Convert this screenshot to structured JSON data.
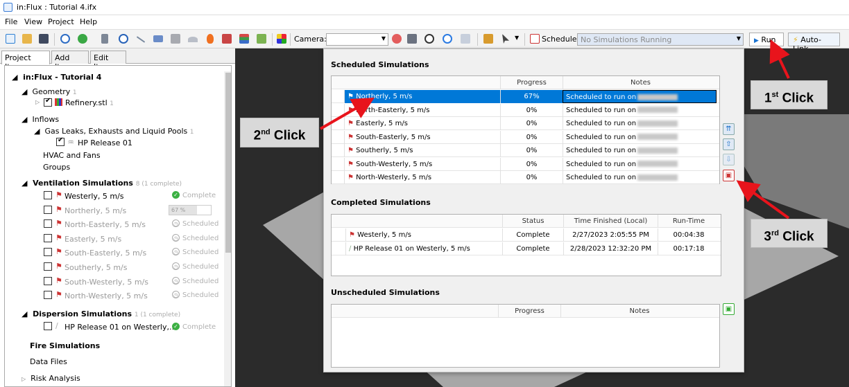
{
  "window": {
    "title": "in:Flux : Tutorial 4.ifx"
  },
  "menu": [
    "File",
    "View",
    "Project",
    "Help"
  ],
  "toolbar": {
    "camera_label": "Camera:",
    "camera_value": "",
    "schedule_label": "Schedule:",
    "schedule_value": "No Simulations Running",
    "run_label": "Run",
    "autolink_label": "Auto-Link"
  },
  "tabs": [
    "Project Items",
    "Add Item",
    "Edit Item"
  ],
  "tree": {
    "root": "in:Flux - Tutorial 4",
    "geometry": {
      "label": "Geometry",
      "count": "1",
      "item": "Refinery.stl",
      "item_count": "1"
    },
    "inflows": {
      "label": "Inflows",
      "gas_label": "Gas Leaks, Exhausts and Liquid Pools",
      "gas_count": "1",
      "gas_item": "HP Release 01",
      "hvac": "HVAC and Fans",
      "groups": "Groups"
    },
    "ventilation": {
      "label": "Ventilation Simulations",
      "count": "8 (1 complete)",
      "items": [
        {
          "name": "Westerly, 5 m/s",
          "status": "Complete"
        },
        {
          "name": "Northerly, 5 m/s",
          "status": "67 %"
        },
        {
          "name": "North-Easterly, 5 m/s",
          "status": "Scheduled"
        },
        {
          "name": "Easterly, 5 m/s",
          "status": "Scheduled"
        },
        {
          "name": "South-Easterly, 5 m/s",
          "status": "Scheduled"
        },
        {
          "name": "Southerly, 5 m/s",
          "status": "Scheduled"
        },
        {
          "name": "South-Westerly, 5 m/s",
          "status": "Scheduled"
        },
        {
          "name": "North-Westerly, 5 m/s",
          "status": "Scheduled"
        }
      ]
    },
    "dispersion": {
      "label": "Dispersion Simulations",
      "count": "1 (1 complete)",
      "item": "HP Release 01 on Westerly,...",
      "status": "Complete"
    },
    "fire": "Fire Simulations",
    "datafiles": "Data Files",
    "risk": "Risk Analysis"
  },
  "dialog": {
    "scheduled": {
      "title": "Scheduled Simulations",
      "headers": [
        "Progress",
        "Notes"
      ],
      "rows": [
        {
          "name": "Northerly, 5 m/s",
          "progress": "67%",
          "notes": "Scheduled to run on"
        },
        {
          "name": "North-Easterly, 5 m/s",
          "progress": "0%",
          "notes": "Scheduled to run on"
        },
        {
          "name": "Easterly, 5 m/s",
          "progress": "0%",
          "notes": "Scheduled to run on"
        },
        {
          "name": "South-Easterly, 5 m/s",
          "progress": "0%",
          "notes": "Scheduled to run on"
        },
        {
          "name": "Southerly, 5 m/s",
          "progress": "0%",
          "notes": "Scheduled to run on"
        },
        {
          "name": "South-Westerly, 5 m/s",
          "progress": "0%",
          "notes": "Scheduled to run on"
        },
        {
          "name": "North-Westerly, 5 m/s",
          "progress": "0%",
          "notes": "Scheduled to run on"
        }
      ]
    },
    "completed": {
      "title": "Completed Simulations",
      "headers": [
        "Status",
        "Time Finished (Local)",
        "Run-Time"
      ],
      "rows": [
        {
          "name": "Westerly, 5 m/s",
          "status": "Complete",
          "time": "2/27/2023 2:05:55 PM",
          "runtime": "00:04:38"
        },
        {
          "name": "HP Release 01 on Westerly, 5 m/s",
          "status": "Complete",
          "time": "2/28/2023 12:32:20 PM",
          "runtime": "00:17:18"
        }
      ]
    },
    "unscheduled": {
      "title": "Unscheduled Simulations",
      "headers": [
        "Progress",
        "Notes"
      ]
    }
  },
  "callouts": {
    "first_main": "1",
    "first_sup": "st",
    "first_rest": " Click",
    "second_main": "2",
    "second_sup": "nd",
    "second_rest": " Click",
    "third_main": "3",
    "third_sup": "rd",
    "third_rest": " Click"
  },
  "colors": {
    "accent": "#0078d7",
    "arrow": "#e8141c",
    "viewport_bg": "#2b2b2b"
  }
}
